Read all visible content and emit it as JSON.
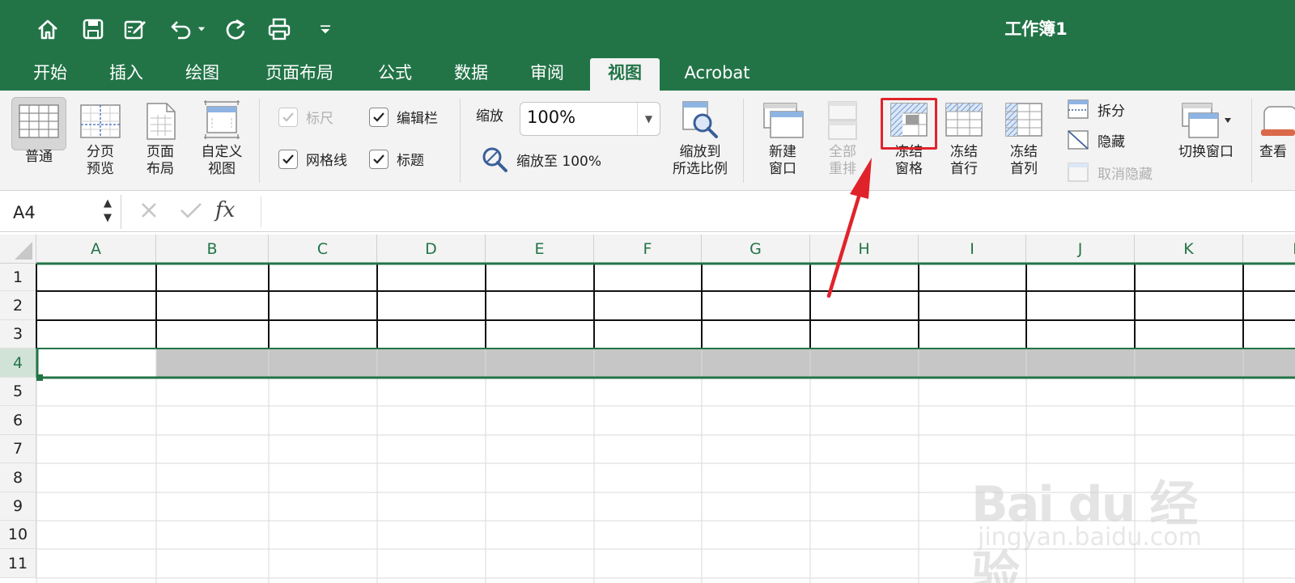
{
  "window": {
    "title": "工作簿1"
  },
  "quick_access": {
    "icons": [
      "home-icon",
      "save-icon",
      "edit-icon",
      "undo-icon",
      "redo-icon",
      "print-icon",
      "customize-icon"
    ]
  },
  "tabs": [
    {
      "label": "开始",
      "active": false
    },
    {
      "label": "插入",
      "active": false
    },
    {
      "label": "绘图",
      "active": false
    },
    {
      "label": "页面布局",
      "active": false
    },
    {
      "label": "公式",
      "active": false
    },
    {
      "label": "数据",
      "active": false
    },
    {
      "label": "审阅",
      "active": false
    },
    {
      "label": "视图",
      "active": true
    },
    {
      "label": "Acrobat",
      "active": false
    }
  ],
  "ribbon": {
    "normal": "普通",
    "page_break_l1": "分页",
    "page_break_l2": "预览",
    "page_layout_l1": "页面",
    "page_layout_l2": "布局",
    "custom_view_l1": "自定义",
    "custom_view_l2": "视图",
    "ruler": "标尺",
    "formula_bar": "编辑栏",
    "gridlines": "网格线",
    "headings": "标题",
    "zoom_label": "缩放",
    "zoom_value": "100%",
    "zoom_100": "缩放至 100%",
    "zoom_selection_l1": "缩放到",
    "zoom_selection_l2": "所选比例",
    "new_window_l1": "新建",
    "new_window_l2": "窗口",
    "arrange_all_l1": "全部",
    "arrange_all_l2": "重排",
    "freeze_panes_l1": "冻结",
    "freeze_panes_l2": "窗格",
    "freeze_top_row_l1": "冻结",
    "freeze_top_row_l2": "首行",
    "freeze_first_col_l1": "冻结",
    "freeze_first_col_l2": "首列",
    "split": "拆分",
    "hide": "隐藏",
    "unhide": "取消隐藏",
    "switch_windows": "切换窗口",
    "view_partial": "查看"
  },
  "formula_bar": {
    "name_box": "A4",
    "fx_label": "fx",
    "formula": ""
  },
  "sheet": {
    "columns": [
      "A",
      "B",
      "C",
      "D",
      "E",
      "F",
      "G",
      "H",
      "I",
      "J",
      "K",
      "L"
    ],
    "rows": [
      "1",
      "2",
      "3",
      "4",
      "5",
      "6",
      "7",
      "8",
      "9",
      "10",
      "11"
    ],
    "selected_row": "4",
    "active_cell": "A4"
  },
  "watermark": {
    "logo": "Bai du 经验",
    "sub": "jingyan.baidu.com"
  },
  "colors": {
    "accent": "#227447",
    "highlight": "#e0232b",
    "selection_fill": "#c6c6c6"
  }
}
